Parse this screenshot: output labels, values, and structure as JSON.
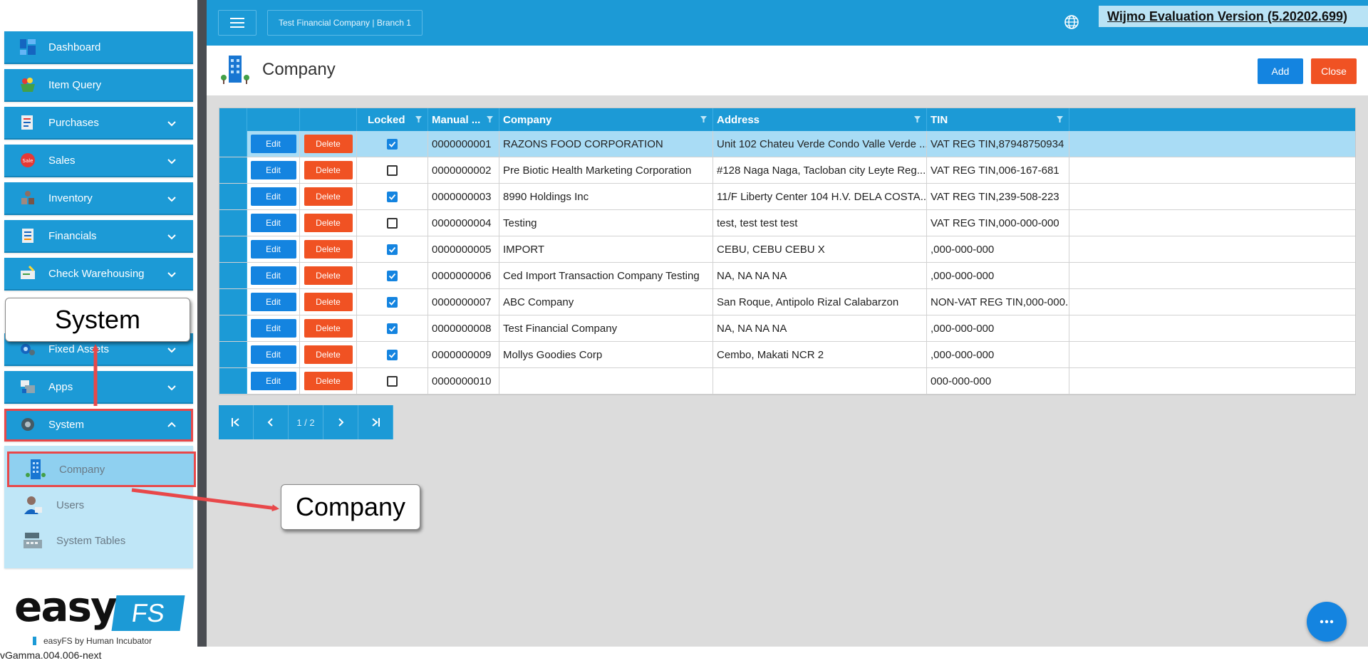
{
  "sidebar": {
    "items": [
      {
        "label": "Dashboard",
        "icon": "dashboard-icon"
      },
      {
        "label": "Item Query",
        "icon": "basket-icon"
      },
      {
        "label": "Purchases",
        "icon": "purchases-icon"
      },
      {
        "label": "Sales",
        "icon": "sales-icon"
      },
      {
        "label": "Inventory",
        "icon": "inventory-icon"
      },
      {
        "label": "Financials",
        "icon": "financials-icon"
      },
      {
        "label": "Check Warehousing",
        "icon": "check-icon"
      },
      {
        "label": "Fixed Assets",
        "icon": "fixed-assets-icon"
      },
      {
        "label": "Apps",
        "icon": "apps-icon"
      },
      {
        "label": "System",
        "icon": "gear-icon"
      }
    ],
    "submenu": [
      {
        "label": "Company",
        "icon": "building-icon"
      },
      {
        "label": "Users",
        "icon": "user-icon"
      },
      {
        "label": "System Tables",
        "icon": "cash-register-icon"
      }
    ],
    "logo": {
      "easy": "easy",
      "fs": "FS",
      "tagline": "easyFS by Human Incubator"
    },
    "version": "vGamma.004.006-next"
  },
  "topbar": {
    "company_branch": "Test Financial Company | Branch 1",
    "wijmo_notice": "Wijmo Evaluation Version (5.20202.699)"
  },
  "page": {
    "title": "Company",
    "add_label": "Add",
    "close_label": "Close"
  },
  "grid": {
    "columns": {
      "locked": "Locked",
      "manual": "Manual ...",
      "company": "Company",
      "address": "Address",
      "tin": "TIN"
    },
    "edit_label": "Edit",
    "delete_label": "Delete",
    "rows": [
      {
        "locked": true,
        "manual": "0000000001",
        "company": "RAZONS FOOD CORPORATION",
        "address": "Unit 102 Chateu Verde Condo Valle Verde ...",
        "tin": "VAT REG TIN,87948750934"
      },
      {
        "locked": false,
        "manual": "0000000002",
        "company": "Pre Biotic Health Marketing Corporation",
        "address": "#128 Naga Naga, Tacloban city Leyte Reg...",
        "tin": "VAT REG TIN,006-167-681"
      },
      {
        "locked": true,
        "manual": "0000000003",
        "company": "8990 Holdings Inc",
        "address": "11/F Liberty Center 104 H.V. DELA COSTA...",
        "tin": "VAT REG TIN,239-508-223"
      },
      {
        "locked": false,
        "manual": "0000000004",
        "company": "Testing",
        "address": "test, test test test",
        "tin": "VAT REG TIN,000-000-000"
      },
      {
        "locked": true,
        "manual": "0000000005",
        "company": "IMPORT",
        "address": "CEBU, CEBU CEBU X",
        "tin": ",000-000-000"
      },
      {
        "locked": true,
        "manual": "0000000006",
        "company": "Ced Import Transaction Company Testing",
        "address": "NA, NA NA NA",
        "tin": ",000-000-000"
      },
      {
        "locked": true,
        "manual": "0000000007",
        "company": "ABC Company",
        "address": "San Roque, Antipolo Rizal Calabarzon",
        "tin": "NON-VAT REG TIN,000-000..."
      },
      {
        "locked": true,
        "manual": "0000000008",
        "company": "Test Financial Company",
        "address": "NA, NA NA NA",
        "tin": ",000-000-000"
      },
      {
        "locked": true,
        "manual": "0000000009",
        "company": "Mollys Goodies Corp",
        "address": "Cembo, Makati NCR 2",
        "tin": ",000-000-000"
      },
      {
        "locked": false,
        "manual": "0000000010",
        "company": "",
        "address": "",
        "tin": "000-000-000"
      }
    ]
  },
  "pager": {
    "info": "1 / 2"
  },
  "annotations": {
    "system": "System",
    "company": "Company"
  },
  "colors": {
    "primary": "#1c9ad6",
    "button_blue": "#1484e0",
    "button_orange": "#f05223",
    "highlight": "#e8484a"
  }
}
